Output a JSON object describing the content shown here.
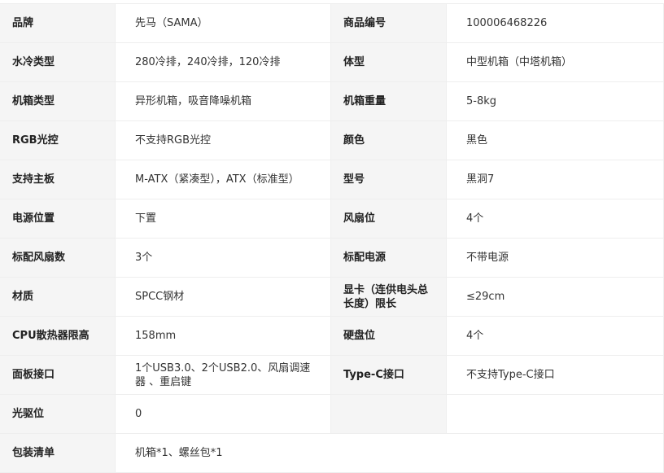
{
  "rows": [
    {
      "left_label": "品牌",
      "left_value": "先马（SAMA）",
      "right_label": "商品编号",
      "right_value": "100006468226"
    },
    {
      "left_label": "水冷类型",
      "left_value": "280冷排，240冷排，120冷排",
      "right_label": "体型",
      "right_value": "中型机箱（中塔机箱）"
    },
    {
      "left_label": "机箱类型",
      "left_value": "异形机箱，吸音降噪机箱",
      "right_label": "机箱重量",
      "right_value": "5-8kg"
    },
    {
      "left_label": "RGB光控",
      "left_value": "不支持RGB光控",
      "right_label": "颜色",
      "right_value": "黑色"
    },
    {
      "left_label": "支持主板",
      "left_value": "M-ATX（紧凑型），ATX（标准型）",
      "right_label": "型号",
      "right_value": "黑洞7"
    },
    {
      "left_label": "电源位置",
      "left_value": "下置",
      "right_label": "风扇位",
      "right_value": "4个"
    },
    {
      "left_label": "标配风扇数",
      "left_value": "3个",
      "right_label": "标配电源",
      "right_value": "不带电源"
    },
    {
      "left_label": "材质",
      "left_value": "SPCC钢材",
      "right_label": "显卡（连供电头总长度）限长",
      "right_value": "≤29cm"
    },
    {
      "left_label": "CPU散热器限高",
      "left_value": "158mm",
      "right_label": "硬盘位",
      "right_value": "4个"
    },
    {
      "left_label": "面板接口",
      "left_value": "1个USB3.0、2个USB2.0、风扇调速器 、重启键",
      "right_label": "Type-C接口",
      "right_value": "不支持Type-C接口"
    },
    {
      "left_label": "光驱位",
      "left_value": "0",
      "right_label": "",
      "right_value": ""
    }
  ],
  "full_row": {
    "label": "包装清单",
    "value": "机箱*1、螺丝包*1"
  }
}
